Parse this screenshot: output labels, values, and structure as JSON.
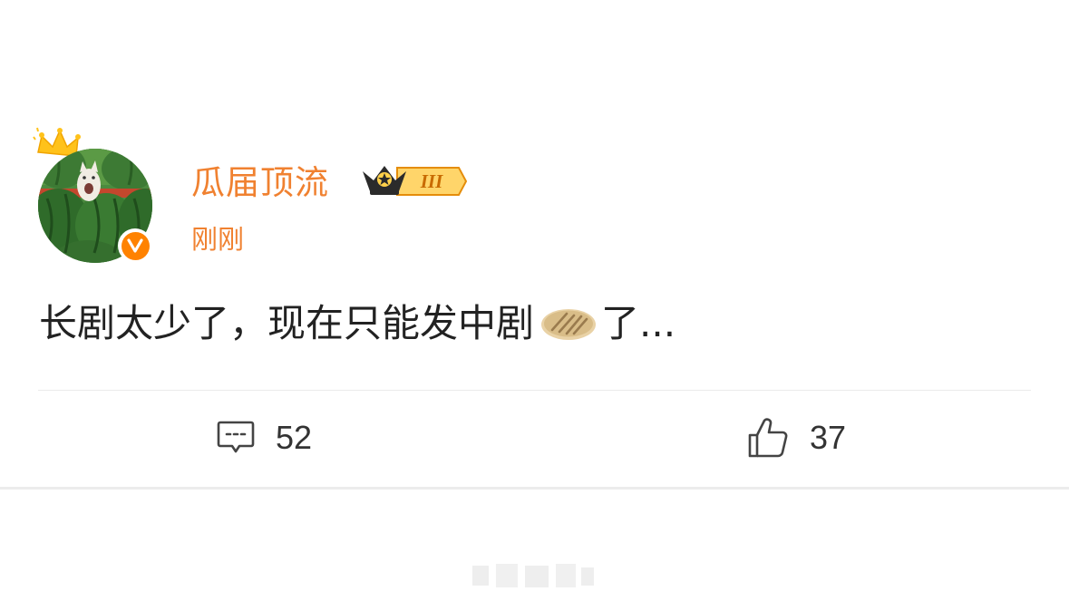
{
  "post": {
    "username": "瓜届顶流",
    "vip_level": "III",
    "timestamp": "刚刚",
    "text_before_emoji": "长剧太少了，现在只能发中剧",
    "emoji_icon": "pancake-emoji-icon",
    "text_after_emoji": "了...",
    "comment_count": "52",
    "like_count": "37"
  },
  "colors": {
    "accent": "#f08130",
    "verified": "#ff8200",
    "text": "#222222",
    "divider": "#ebebeb"
  }
}
